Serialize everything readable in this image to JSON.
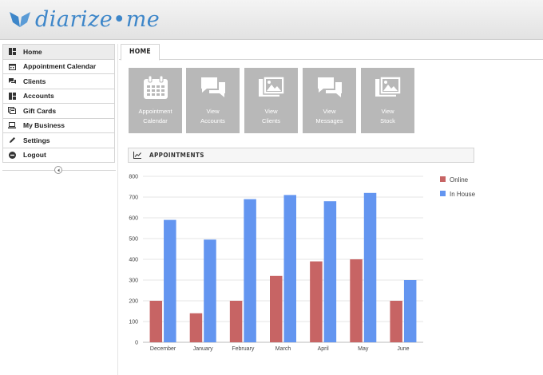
{
  "app": {
    "logo_text": "diarize•me"
  },
  "colors": {
    "online": "#c76464",
    "in_house": "#6395f0",
    "tile_bg": "#b8b8b8",
    "logo": "#3d86c9"
  },
  "sidebar": {
    "items": [
      {
        "label": "Home",
        "icon": "grid-icon",
        "active": true
      },
      {
        "label": "Appointment Calendar",
        "icon": "calendar-icon"
      },
      {
        "label": "Clients",
        "icon": "chat-icon"
      },
      {
        "label": "Accounts",
        "icon": "grid-icon"
      },
      {
        "label": "Gift Cards",
        "icon": "gift-card-icon"
      },
      {
        "label": "My Business",
        "icon": "laptop-icon"
      },
      {
        "label": "Settings",
        "icon": "pencil-icon"
      },
      {
        "label": "Logout",
        "icon": "minus-circle-icon"
      }
    ]
  },
  "tabs": [
    {
      "label": "HOME"
    }
  ],
  "tiles": [
    {
      "line1": "Appointment",
      "line2": "Calendar",
      "icon": "calendar-icon"
    },
    {
      "line1": "View",
      "line2": "Accounts",
      "icon": "chat-icon"
    },
    {
      "line1": "View",
      "line2": "Clients",
      "icon": "image-icon"
    },
    {
      "line1": "View",
      "line2": "Messages",
      "icon": "chat-icon"
    },
    {
      "line1": "View",
      "line2": "Stock",
      "icon": "image-icon"
    }
  ],
  "panel": {
    "title": "APPOINTMENTS",
    "icon": "line-chart-icon"
  },
  "chart_data": {
    "type": "bar",
    "categories": [
      "December",
      "January",
      "February",
      "March",
      "April",
      "May",
      "June"
    ],
    "series": [
      {
        "name": "Online",
        "values": [
          200,
          140,
          200,
          320,
          390,
          400,
          200
        ]
      },
      {
        "name": "In House",
        "values": [
          590,
          495,
          690,
          710,
          680,
          720,
          300
        ]
      }
    ],
    "ylim": [
      0,
      800
    ],
    "yticks": [
      0,
      100,
      200,
      300,
      400,
      500,
      600,
      700,
      800
    ],
    "grid": true,
    "legend": "right"
  }
}
